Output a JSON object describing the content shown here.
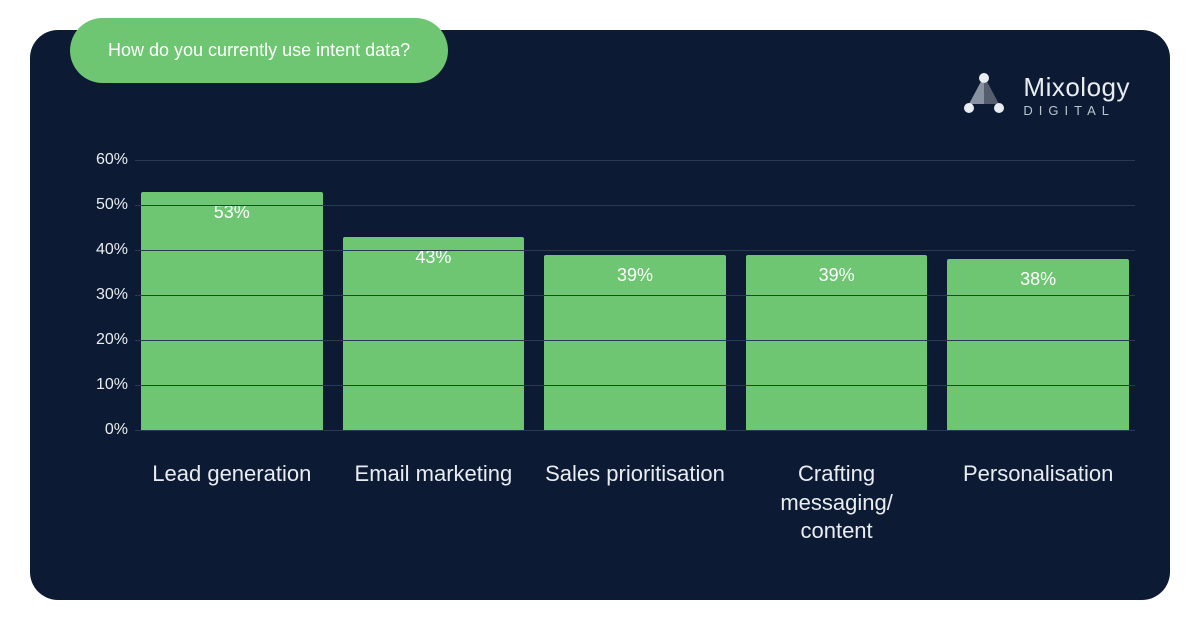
{
  "title": "How do you currently use intent data?",
  "brand": {
    "name": "Mixology",
    "sub": "DIGITAL"
  },
  "chart_data": {
    "type": "bar",
    "title": "How do you currently use intent data?",
    "xlabel": "",
    "ylabel": "",
    "ylim": [
      0,
      60
    ],
    "yticks": [
      0,
      10,
      20,
      30,
      40,
      50,
      60
    ],
    "categories": [
      "Lead generation",
      "Email marketing",
      "Sales prioritisation",
      "Crafting messaging/ content",
      "Personalisation"
    ],
    "values": [
      53,
      43,
      39,
      39,
      38
    ],
    "value_labels": [
      "53%",
      "43%",
      "39%",
      "39%",
      "38%"
    ]
  },
  "ytick_labels": [
    "0%",
    "10%",
    "20%",
    "30%",
    "40%",
    "50%",
    "60%"
  ],
  "colors": {
    "card": "#0c1b33",
    "accent": "#6ec572",
    "text": "#e9edf2"
  }
}
